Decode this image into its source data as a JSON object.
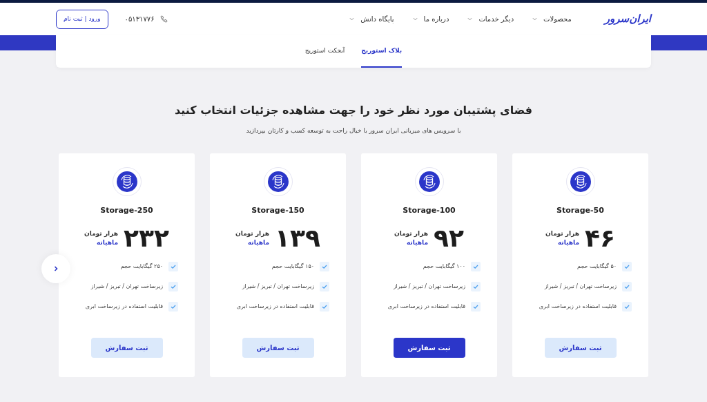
{
  "header": {
    "logo": "ایران‌سرور",
    "nav": [
      {
        "label": "محصولات"
      },
      {
        "label": "دیگر خدمات"
      },
      {
        "label": "درباره ما"
      },
      {
        "label": "پایگاه دانش"
      }
    ],
    "phone": "۰۵۱۳۱۷۷۶",
    "login_button": "ورود | ثبت نام"
  },
  "tabs": [
    {
      "label": "بلاک استوریج",
      "selected": true
    },
    {
      "label": "آبجکت استوریج",
      "selected": false
    }
  ],
  "heading": "فضای پشتیبان مورد نظر خود را جهت مشاهده جزئیات انتخاب کنید",
  "subheading": "با سرویس های میزبانی ایران سرور با خیال راحت به توسعه کسب و کارتان بپردازید",
  "plans": [
    {
      "name": "Storage-50",
      "price": "۴۶",
      "unit": "هزار تومان",
      "period": "ماهیانه",
      "features": [
        "۵۰ گیگابایت حجم",
        "زیرساخت تهران / تبریز / شیراز",
        "قابلیت استفاده در زیرساخت ابری"
      ],
      "button": "ثبت سفارش",
      "highlighted": false
    },
    {
      "name": "Storage-100",
      "price": "۹۲",
      "unit": "هزار تومان",
      "period": "ماهیانه",
      "features": [
        "۱۰۰ گیگابایت حجم",
        "زیرساخت تهران / تبریز / شیراز",
        "قابلیت استفاده در زیرساخت ابری"
      ],
      "button": "ثبت سفارش",
      "highlighted": true
    },
    {
      "name": "Storage-150",
      "price": "۱۳۹",
      "unit": "هزار تومان",
      "period": "ماهیانه",
      "features": [
        "۱۵۰ گیگابایت حجم",
        "زیرساخت تهران / تبریز / شیراز",
        "قابلیت استفاده در زیرساخت ابری"
      ],
      "button": "ثبت سفارش",
      "highlighted": false
    },
    {
      "name": "Storage-250",
      "price": "۲۳۲",
      "unit": "هزار تومان",
      "period": "ماهیانه",
      "features": [
        "۲۵۰ گیگابایت حجم",
        "زیرساخت تهران / تبریز / شیراز",
        "قابلیت استفاده در زیرساخت ابری"
      ],
      "button": "ثبت سفارش",
      "highlighted": false
    }
  ]
}
